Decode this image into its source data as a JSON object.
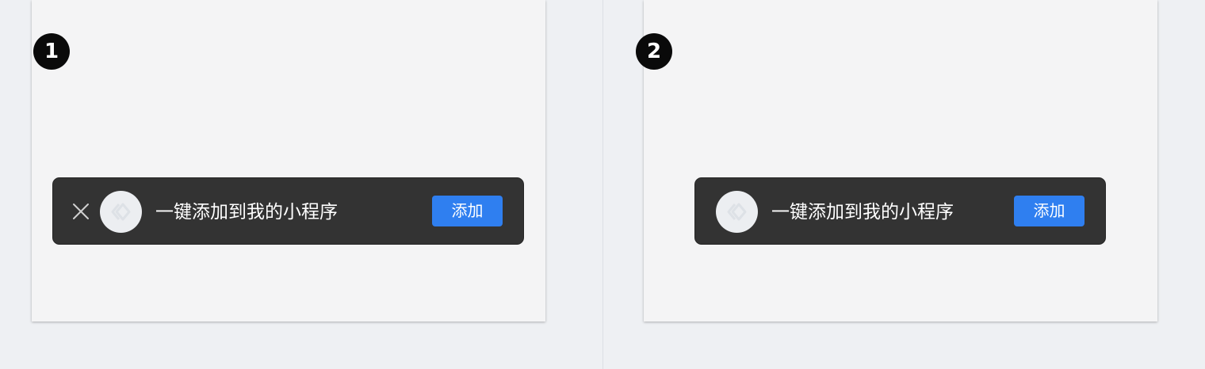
{
  "steps": [
    {
      "number": "1"
    },
    {
      "number": "2"
    }
  ],
  "prompt_bar": {
    "message": "一键添加到我的小程序",
    "add_label": "添加",
    "icon": "mini-program-logo-icon",
    "close_icon": "close-icon"
  },
  "colors": {
    "bar_background": "#333333",
    "add_button": "#2f7ff0",
    "badge": "#0a0a0a",
    "panel": "#f4f4f5",
    "page": "#eef0f3"
  }
}
